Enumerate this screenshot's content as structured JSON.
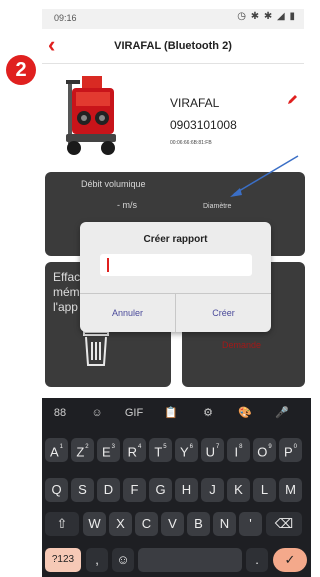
{
  "status_bar": {
    "time": "09:16",
    "icons": "◷ ✱ ✱ ◢ ▮"
  },
  "header": {
    "title": "VIRAFAL (Bluetooth 2)"
  },
  "step_badge": "2",
  "device": {
    "name": "VIRAFAL",
    "serial": "0903101008",
    "mac": "00:06:66:6B:81:FB"
  },
  "measure_tile": {
    "label": "Débit volumique",
    "value": "- m/s",
    "diameter_label": "Diamètre"
  },
  "left_tile": {
    "lines": [
      "Effac",
      "mém",
      "l'app"
    ]
  },
  "right_tile": {
    "demande": "Demande"
  },
  "dialog": {
    "title": "Créer rapport",
    "input_value": "",
    "cancel_label": "Annuler",
    "create_label": "Créer"
  },
  "keyboard": {
    "toolbar": [
      "88",
      "☺",
      "GIF",
      "📋",
      "⚙",
      "🎨",
      "🎤"
    ],
    "row1": [
      {
        "k": "A",
        "s": "1"
      },
      {
        "k": "Z",
        "s": "2"
      },
      {
        "k": "E",
        "s": "3"
      },
      {
        "k": "R",
        "s": "4"
      },
      {
        "k": "T",
        "s": "5"
      },
      {
        "k": "Y",
        "s": "6"
      },
      {
        "k": "U",
        "s": "7"
      },
      {
        "k": "I",
        "s": "8"
      },
      {
        "k": "O",
        "s": "9"
      },
      {
        "k": "P",
        "s": "0"
      }
    ],
    "row2": [
      "Q",
      "S",
      "D",
      "F",
      "G",
      "H",
      "J",
      "K",
      "L",
      "M"
    ],
    "row3": [
      "W",
      "X",
      "C",
      "V",
      "B",
      "N",
      "'"
    ],
    "shift": "⇧",
    "backspace": "⌫",
    "symbols": "?123",
    "comma": ",",
    "emoji": "☺",
    "period": ".",
    "enter": "✓"
  },
  "colors": {
    "accent_red": "#e0201f",
    "dialog_button_text": "#4a4a9a",
    "keyboard_bg": "#1e1f23",
    "annotation_arrow": "#3b6fc6"
  }
}
